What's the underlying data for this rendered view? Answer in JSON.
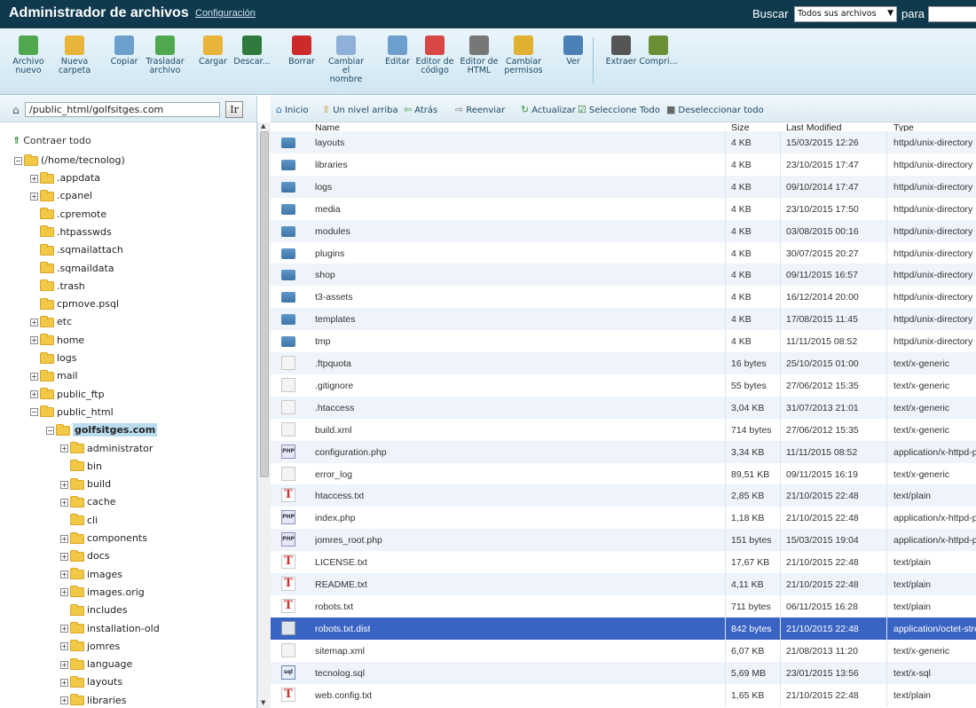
{
  "header": {
    "title": "Administrador de archivos",
    "config_link": "Configuración",
    "search_label": "Buscar",
    "search_scope": "Todos sus archivos",
    "para_label": "para"
  },
  "toolbar": {
    "buttons": [
      {
        "label": "Archivo nuevo",
        "icon": "new-file-icon"
      },
      {
        "label": "Nueva carpeta",
        "icon": "new-folder-icon"
      },
      {
        "label": "Copiar",
        "icon": "copy-icon"
      },
      {
        "label": "Trasladar archivo",
        "icon": "move-icon"
      },
      {
        "label": "Cargar",
        "icon": "upload-icon"
      },
      {
        "label": "Descar...",
        "icon": "download-icon"
      },
      {
        "label": "Borrar",
        "icon": "delete-icon"
      },
      {
        "label": "Cambiar el nombre",
        "icon": "rename-icon"
      },
      {
        "label": "Editar",
        "icon": "edit-icon"
      },
      {
        "label": "Editor de código",
        "icon": "code-editor-icon"
      },
      {
        "label": "Editor de HTML",
        "icon": "html-editor-icon"
      },
      {
        "label": "Cambiar permisos",
        "icon": "permissions-icon"
      },
      {
        "label": "Ver",
        "icon": "view-icon"
      },
      {
        "label": "Extraer",
        "icon": "extract-icon"
      },
      {
        "label": "Compri...",
        "icon": "compress-icon"
      }
    ]
  },
  "path": {
    "value": "/public_html/golfsitges.com",
    "go_label": "Ir"
  },
  "tree": {
    "collapse_label": "Contraer todo",
    "root": "(/home/tecnolog)",
    "nodes": [
      {
        "label": ".appdata",
        "level": 1,
        "expander": "+"
      },
      {
        "label": ".cpanel",
        "level": 1,
        "expander": "+"
      },
      {
        "label": ".cpremote",
        "level": 1,
        "expander": ""
      },
      {
        "label": ".htpasswds",
        "level": 1,
        "expander": ""
      },
      {
        "label": ".sqmailattach",
        "level": 1,
        "expander": ""
      },
      {
        "label": ".sqmaildata",
        "level": 1,
        "expander": ""
      },
      {
        "label": ".trash",
        "level": 1,
        "expander": ""
      },
      {
        "label": "cpmove.psql",
        "level": 1,
        "expander": ""
      },
      {
        "label": "etc",
        "level": 1,
        "expander": "+"
      },
      {
        "label": "home",
        "level": 1,
        "expander": "+"
      },
      {
        "label": "logs",
        "level": 1,
        "expander": ""
      },
      {
        "label": "mail",
        "level": 1,
        "expander": "+"
      },
      {
        "label": "public_ftp",
        "level": 1,
        "expander": "+"
      },
      {
        "label": "public_html",
        "level": 1,
        "expander": "-"
      },
      {
        "label": "golfsitges.com",
        "level": 2,
        "expander": "-",
        "selected": true
      },
      {
        "label": "administrator",
        "level": 3,
        "expander": "+"
      },
      {
        "label": "bin",
        "level": 3,
        "expander": ""
      },
      {
        "label": "build",
        "level": 3,
        "expander": "+"
      },
      {
        "label": "cache",
        "level": 3,
        "expander": "+"
      },
      {
        "label": "cli",
        "level": 3,
        "expander": ""
      },
      {
        "label": "components",
        "level": 3,
        "expander": "+"
      },
      {
        "label": "docs",
        "level": 3,
        "expander": "+"
      },
      {
        "label": "images",
        "level": 3,
        "expander": "+"
      },
      {
        "label": "images.orig",
        "level": 3,
        "expander": "+"
      },
      {
        "label": "includes",
        "level": 3,
        "expander": ""
      },
      {
        "label": "installation-old",
        "level": 3,
        "expander": "+"
      },
      {
        "label": "jomres",
        "level": 3,
        "expander": "+"
      },
      {
        "label": "language",
        "level": 3,
        "expander": "+"
      },
      {
        "label": "layouts",
        "level": 3,
        "expander": "+"
      },
      {
        "label": "libraries",
        "level": 3,
        "expander": "+"
      }
    ]
  },
  "navbar": {
    "items": [
      {
        "label": "Inicio",
        "icon": "home-icon"
      },
      {
        "label": "Un nivel arriba",
        "icon": "up-level-icon"
      },
      {
        "label": "Atrás",
        "icon": "back-arrow-icon"
      },
      {
        "label": "Reenviar",
        "icon": "forward-arrow-icon"
      },
      {
        "label": "Actualizar",
        "icon": "refresh-icon"
      },
      {
        "label": "Seleccione Todo",
        "icon": "checkbox-checked-icon"
      },
      {
        "label": "Deseleccionar todo",
        "icon": "checkbox-empty-icon"
      }
    ]
  },
  "table": {
    "columns": [
      "Name",
      "Size",
      "Last Modified",
      "Type"
    ],
    "rows": [
      {
        "name": "layouts",
        "size": "4 KB",
        "modified": "15/03/2015 12:26",
        "type": "httpd/unix-directory",
        "icon": "dir"
      },
      {
        "name": "libraries",
        "size": "4 KB",
        "modified": "23/10/2015 17:47",
        "type": "httpd/unix-directory",
        "icon": "dir"
      },
      {
        "name": "logs",
        "size": "4 KB",
        "modified": "09/10/2014 17:47",
        "type": "httpd/unix-directory",
        "icon": "dir"
      },
      {
        "name": "media",
        "size": "4 KB",
        "modified": "23/10/2015 17:50",
        "type": "httpd/unix-directory",
        "icon": "dir"
      },
      {
        "name": "modules",
        "size": "4 KB",
        "modified": "03/08/2015 00:16",
        "type": "httpd/unix-directory",
        "icon": "dir"
      },
      {
        "name": "plugins",
        "size": "4 KB",
        "modified": "30/07/2015 20:27",
        "type": "httpd/unix-directory",
        "icon": "dir"
      },
      {
        "name": "shop",
        "size": "4 KB",
        "modified": "09/11/2015 16:57",
        "type": "httpd/unix-directory",
        "icon": "dir"
      },
      {
        "name": "t3-assets",
        "size": "4 KB",
        "modified": "16/12/2014 20:00",
        "type": "httpd/unix-directory",
        "icon": "dir"
      },
      {
        "name": "templates",
        "size": "4 KB",
        "modified": "17/08/2015 11:45",
        "type": "httpd/unix-directory",
        "icon": "dir"
      },
      {
        "name": "tmp",
        "size": "4 KB",
        "modified": "11/11/2015 08:52",
        "type": "httpd/unix-directory",
        "icon": "dir"
      },
      {
        "name": ".ftpquota",
        "size": "16 bytes",
        "modified": "25/10/2015 01:00",
        "type": "text/x-generic",
        "icon": "generic"
      },
      {
        "name": ".gitignore",
        "size": "55 bytes",
        "modified": "27/06/2012 15:35",
        "type": "text/x-generic",
        "icon": "generic"
      },
      {
        "name": ".htaccess",
        "size": "3,04 KB",
        "modified": "31/07/2013 21:01",
        "type": "text/x-generic",
        "icon": "generic"
      },
      {
        "name": "build.xml",
        "size": "714 bytes",
        "modified": "27/06/2012 15:35",
        "type": "text/x-generic",
        "icon": "generic"
      },
      {
        "name": "configuration.php",
        "size": "3,34 KB",
        "modified": "11/11/2015 08:52",
        "type": "application/x-httpd-p",
        "icon": "php"
      },
      {
        "name": "error_log",
        "size": "89,51 KB",
        "modified": "09/11/2015 16:19",
        "type": "text/x-generic",
        "icon": "generic"
      },
      {
        "name": "htaccess.txt",
        "size": "2,85 KB",
        "modified": "21/10/2015 22:48",
        "type": "text/plain",
        "icon": "txt"
      },
      {
        "name": "index.php",
        "size": "1,18 KB",
        "modified": "21/10/2015 22:48",
        "type": "application/x-httpd-p",
        "icon": "php"
      },
      {
        "name": "jomres_root.php",
        "size": "151 bytes",
        "modified": "15/03/2015 19:04",
        "type": "application/x-httpd-p",
        "icon": "php"
      },
      {
        "name": "LICENSE.txt",
        "size": "17,67 KB",
        "modified": "21/10/2015 22:48",
        "type": "text/plain",
        "icon": "txt"
      },
      {
        "name": "README.txt",
        "size": "4,11 KB",
        "modified": "21/10/2015 22:48",
        "type": "text/plain",
        "icon": "txt"
      },
      {
        "name": "robots.txt",
        "size": "711 bytes",
        "modified": "06/11/2015 16:28",
        "type": "text/plain",
        "icon": "txt"
      },
      {
        "name": "robots.txt.dist",
        "size": "842 bytes",
        "modified": "21/10/2015 22:48",
        "type": "application/octet-stre",
        "icon": "bin",
        "selected": true
      },
      {
        "name": "sitemap.xml",
        "size": "6,07 KB",
        "modified": "21/08/2013 11:20",
        "type": "text/x-generic",
        "icon": "generic"
      },
      {
        "name": "tecnolog.sql",
        "size": "5,69 MB",
        "modified": "23/01/2015 13:56",
        "type": "text/x-sql",
        "icon": "sql"
      },
      {
        "name": "web.config.txt",
        "size": "1,65 KB",
        "modified": "21/10/2015 22:48",
        "type": "text/plain",
        "icon": "txt"
      }
    ]
  },
  "colors": {
    "header_bg": "#0f3a4e",
    "selected_row": "#3a64c4",
    "alt_row": "#eef4fa",
    "folder_blue": "#4a80b5"
  }
}
